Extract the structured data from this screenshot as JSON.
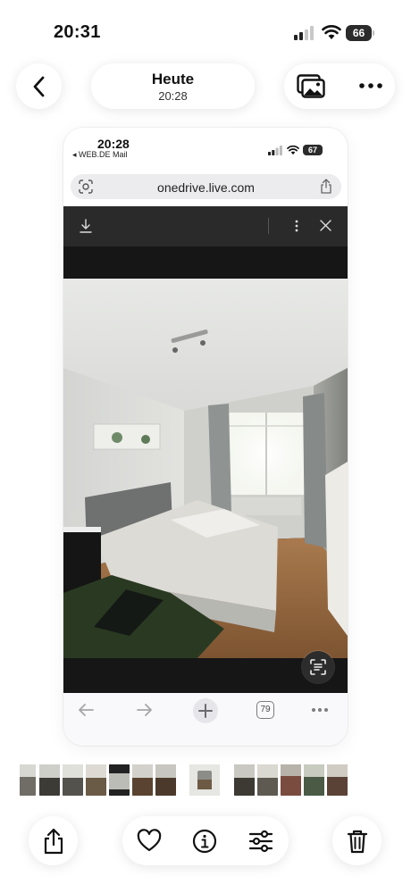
{
  "status_bar": {
    "time": "20:31",
    "battery": "66"
  },
  "header": {
    "title": "Heute",
    "subtitle": "20:28"
  },
  "inner_screenshot": {
    "status_bar": {
      "time": "20:28",
      "back_label": "◂ WEB.DE Mail",
      "battery": "67"
    },
    "address_bar": {
      "url": "onedrive.live.com"
    },
    "browser_nav": {
      "tab_count": "79"
    }
  },
  "icons": {
    "back": "chevron-left-icon",
    "gallery": "photo-stack-icon",
    "more": "ellipsis-icon",
    "share": "share-icon",
    "favorite": "heart-icon",
    "info": "info-icon",
    "adjust": "sliders-icon",
    "delete": "trash-icon"
  },
  "colors": {
    "accent": "#111111",
    "viewer_bg": "#161616",
    "pill_bg": "#ffffff"
  }
}
